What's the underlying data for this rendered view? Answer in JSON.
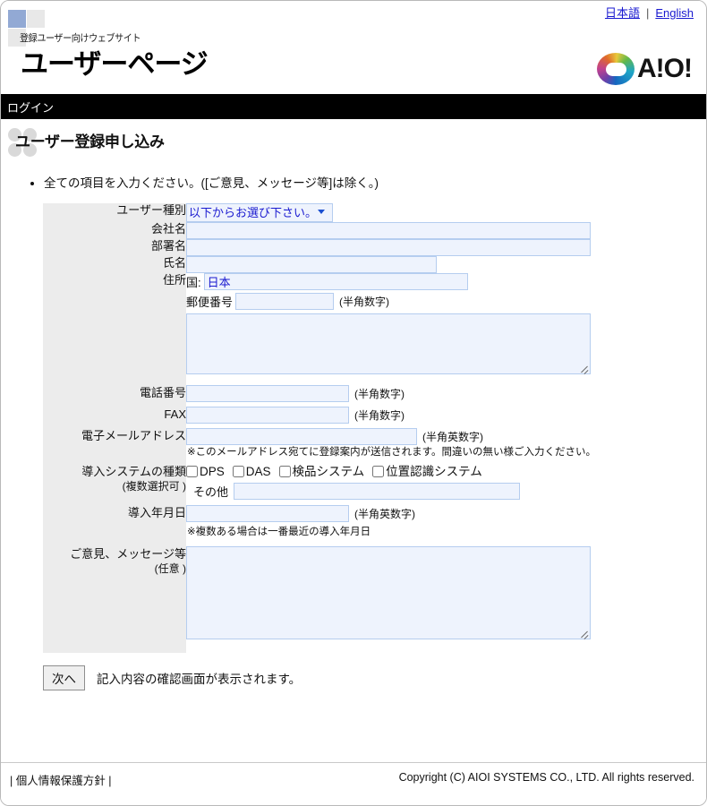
{
  "header": {
    "site_subtitle": "登録ユーザー向けウェブサイト",
    "site_title": "ユーザーページ",
    "logo_text": "A!O!",
    "lang_ja": "日本語",
    "lang_sep": "|",
    "lang_en": "English"
  },
  "nav": {
    "login": "ログイン"
  },
  "main": {
    "page_title": "ユーザー登録申し込み",
    "intro": "全ての項目を入力ください。([ご意見、メッセージ等]は除く。)"
  },
  "form": {
    "user_type": {
      "label": "ユーザー種別",
      "selected": "以下からお選び下さい。"
    },
    "company": {
      "label": "会社名",
      "value": ""
    },
    "department": {
      "label": "部署名",
      "value": ""
    },
    "name": {
      "label": "氏名",
      "value": ""
    },
    "address": {
      "label": "住所",
      "country_label": "国:",
      "country_value": "日本",
      "zip_label": "郵便番号",
      "zip_value": "",
      "zip_hint": "(半角数字)",
      "detail_value": ""
    },
    "tel": {
      "label": "電話番号",
      "value": "",
      "hint": "(半角数字)"
    },
    "fax": {
      "label": "FAX",
      "value": "",
      "hint": "(半角数字)"
    },
    "email": {
      "label": "電子メールアドレス",
      "value": "",
      "hint": "(半角英数字)",
      "note": "※このメールアドレス宛てに登録案内が送信されます。間違いの無い様ご入力ください。"
    },
    "system_type": {
      "label": "導入システムの種類",
      "sub_label": "(複数選択可 )",
      "options": [
        "DPS",
        "DAS",
        "検品システム",
        "位置認識システム"
      ],
      "other_label": "その他",
      "other_value": ""
    },
    "install_date": {
      "label": "導入年月日",
      "value": "",
      "hint": "(半角英数字)",
      "note": "※複数ある場合は一番最近の導入年月日"
    },
    "comment": {
      "label": "ご意見、メッセージ等",
      "sub_label": "(任意 )",
      "value": ""
    }
  },
  "submit": {
    "button": "次へ",
    "note": "記入内容の確認画面が表示されます。"
  },
  "footer": {
    "privacy": "| 個人情報保護方針 |",
    "copyright": "Copyright (C) AIOI SYSTEMS CO., LTD. All rights reserved."
  }
}
